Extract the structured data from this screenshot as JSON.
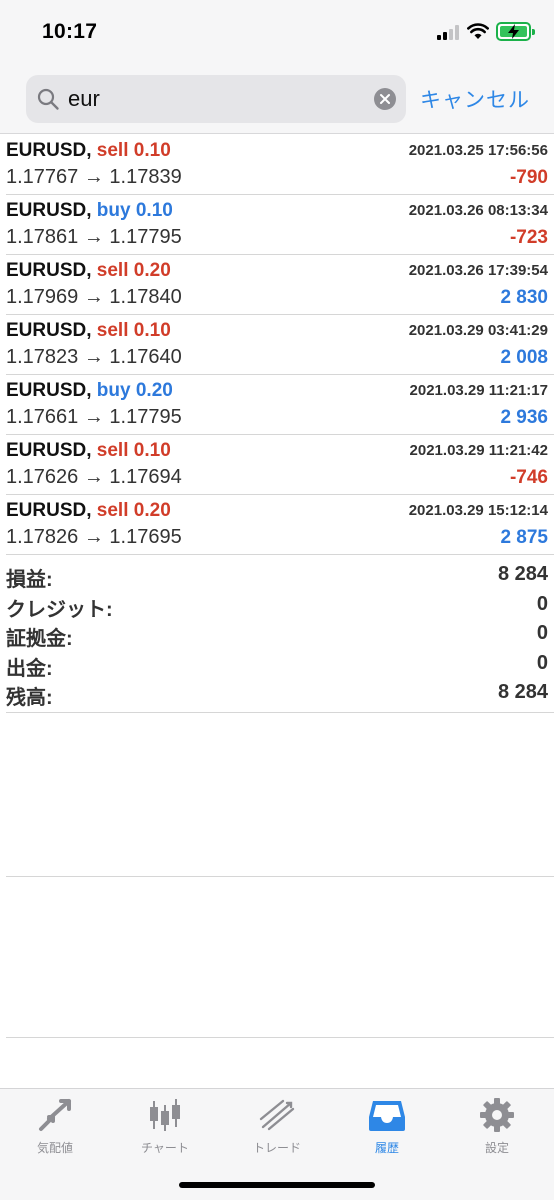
{
  "status_bar": {
    "time": "10:17"
  },
  "search": {
    "value": "eur",
    "cancel_label": "キャンセル"
  },
  "trades": [
    {
      "symbol": "EURUSD,",
      "side": "sell",
      "volume": "0.10",
      "datetime": "2021.03.25 17:56:56",
      "prices": "1.17767 → 1.17839",
      "profit": "-790"
    },
    {
      "symbol": "EURUSD,",
      "side": "buy",
      "volume": "0.10",
      "datetime": "2021.03.26 08:13:34",
      "prices": "1.17861 → 1.17795",
      "profit": "-723"
    },
    {
      "symbol": "EURUSD,",
      "side": "sell",
      "volume": "0.20",
      "datetime": "2021.03.26 17:39:54",
      "prices": "1.17969 → 1.17840",
      "profit": "2 830"
    },
    {
      "symbol": "EURUSD,",
      "side": "sell",
      "volume": "0.10",
      "datetime": "2021.03.29 03:41:29",
      "prices": "1.17823 → 1.17640",
      "profit": "2 008"
    },
    {
      "symbol": "EURUSD,",
      "side": "buy",
      "volume": "0.20",
      "datetime": "2021.03.29 11:21:17",
      "prices": "1.17661 → 1.17795",
      "profit": "2 936"
    },
    {
      "symbol": "EURUSD,",
      "side": "sell",
      "volume": "0.10",
      "datetime": "2021.03.29 11:21:42",
      "prices": "1.17626 → 1.17694",
      "profit": "-746"
    },
    {
      "symbol": "EURUSD,",
      "side": "sell",
      "volume": "0.20",
      "datetime": "2021.03.29 15:12:14",
      "prices": "1.17826 → 1.17695",
      "profit": "2 875"
    }
  ],
  "summary": [
    {
      "label": "損益:",
      "value": "8 284"
    },
    {
      "label": "クレジット:",
      "value": "0"
    },
    {
      "label": "証拠金:",
      "value": "0"
    },
    {
      "label": "出金:",
      "value": "0"
    },
    {
      "label": "残高:",
      "value": "8 284"
    }
  ],
  "tabs": [
    {
      "label": "気配値",
      "icon": "quotes-arrows-icon",
      "active": false
    },
    {
      "label": "チャート",
      "icon": "candlestick-chart-icon",
      "active": false
    },
    {
      "label": "トレード",
      "icon": "trade-lines-icon",
      "active": false
    },
    {
      "label": "履歴",
      "icon": "history-inbox-icon",
      "active": true
    },
    {
      "label": "設定",
      "icon": "gear-icon",
      "active": false
    }
  ],
  "colors": {
    "sell": "#d13d29",
    "buy": "#2d79dc",
    "loss": "#d13d29",
    "profit": "#2d79dc",
    "accent": "#2e87e6",
    "inactive_tab": "#8e8e93"
  }
}
